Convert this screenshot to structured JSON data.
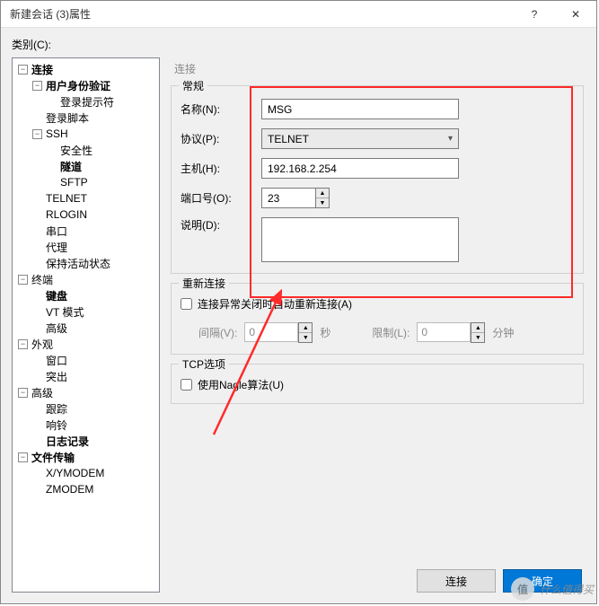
{
  "title": "新建会话 (3)属性",
  "help_glyph": "?",
  "close_glyph": "✕",
  "category_label": "类别(C):",
  "tree": {
    "conn": "连接",
    "auth": "用户身份验证",
    "login_prompt": "登录提示符",
    "login_script": "登录脚本",
    "ssh": "SSH",
    "security": "安全性",
    "tunnel": "隧道",
    "sftp": "SFTP",
    "telnet": "TELNET",
    "rlogin": "RLOGIN",
    "serial": "串口",
    "proxy": "代理",
    "keepalive": "保持活动状态",
    "terminal": "终端",
    "keyboard": "键盘",
    "vt": "VT 模式",
    "adv1": "高级",
    "appearance": "外观",
    "window": "窗口",
    "highlight": "突出",
    "advanced": "高级",
    "trace": "跟踪",
    "bell": "响铃",
    "log": "日志记录",
    "filetrans": "文件传输",
    "xymodem": "X/YMODEM",
    "zmodem": "ZMODEM"
  },
  "right_title": "连接",
  "group_general": "常规",
  "lbl_name": "名称(N):",
  "lbl_proto": "协议(P):",
  "lbl_host": "主机(H):",
  "lbl_port": "端口号(O):",
  "lbl_desc": "说明(D):",
  "val_name": "MSG",
  "val_proto": "TELNET",
  "val_host": "192.168.2.254",
  "val_port": "23",
  "val_desc": "",
  "group_reconnect": "重新连接",
  "chk_auto_reconnect": "连接异常关闭时自动重新连接(A)",
  "lbl_interval": "间隔(V):",
  "val_interval": "0",
  "lbl_sec": "秒",
  "lbl_limit": "限制(L):",
  "val_limit": "0",
  "lbl_min": "分钟",
  "group_tcp": "TCP选项",
  "chk_nagle": "使用Nagle算法(U)",
  "btn_connect": "连接",
  "btn_ok": "确定",
  "watermark_text": "什么值得买",
  "watermark_badge": "值"
}
